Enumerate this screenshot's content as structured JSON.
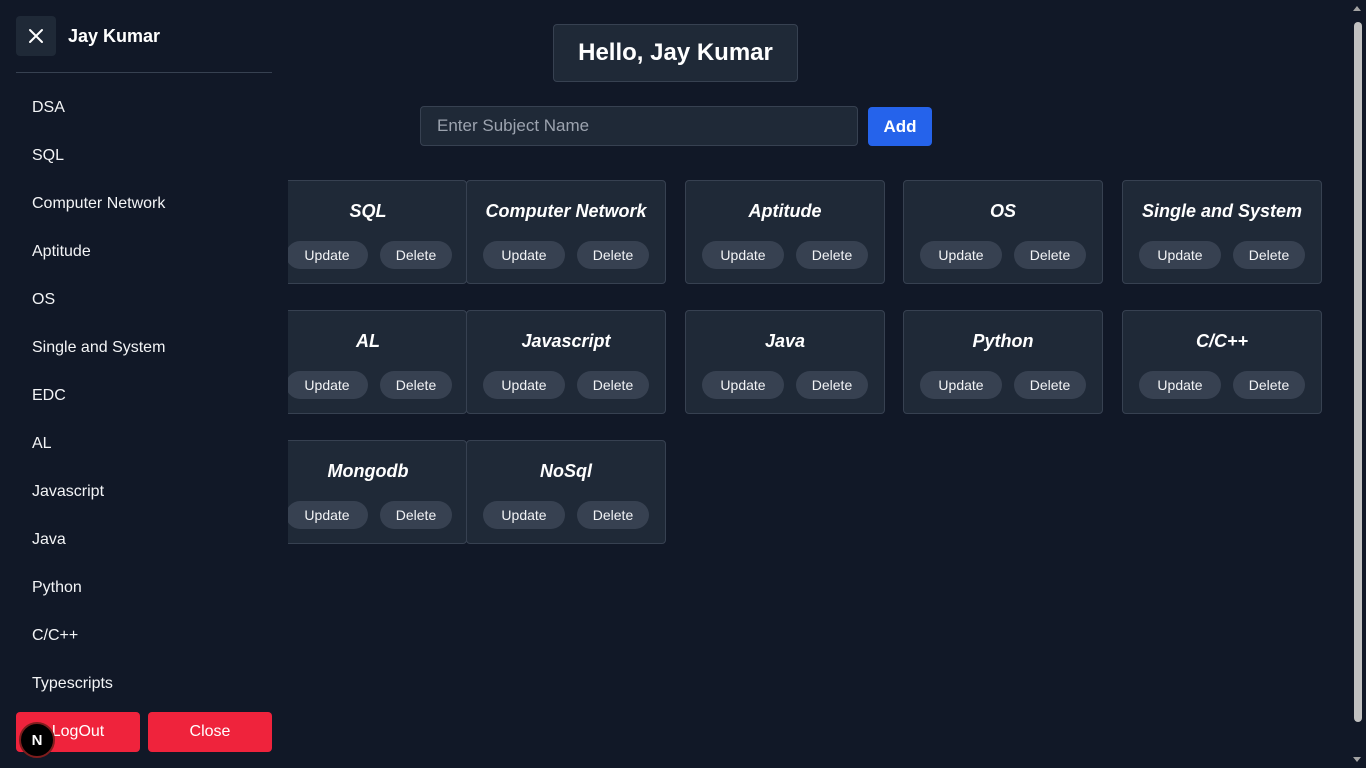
{
  "header": {
    "greeting": "Hello, Jay Kumar"
  },
  "form": {
    "placeholder": "Enter Subject Name",
    "value": "",
    "add_label": "Add"
  },
  "cards": [
    {
      "title": "SQL",
      "update": "Update",
      "delete": "Delete"
    },
    {
      "title": "Computer Network",
      "update": "Update",
      "delete": "Delete"
    },
    {
      "title": "Aptitude",
      "update": "Update",
      "delete": "Delete"
    },
    {
      "title": "OS",
      "update": "Update",
      "delete": "Delete"
    },
    {
      "title": "Single and System",
      "update": "Update",
      "delete": "Delete"
    },
    {
      "title": "AL",
      "update": "Update",
      "delete": "Delete"
    },
    {
      "title": "Javascript",
      "update": "Update",
      "delete": "Delete"
    },
    {
      "title": "Java",
      "update": "Update",
      "delete": "Delete"
    },
    {
      "title": "Python",
      "update": "Update",
      "delete": "Delete"
    },
    {
      "title": "C/C++",
      "update": "Update",
      "delete": "Delete"
    },
    {
      "title": "Mongodb",
      "update": "Update",
      "delete": "Delete"
    },
    {
      "title": "NoSql",
      "update": "Update",
      "delete": "Delete"
    }
  ],
  "sidebar": {
    "user_name": "Jay Kumar",
    "close_icon": "close-icon",
    "items": [
      {
        "label": "DSA"
      },
      {
        "label": "SQL"
      },
      {
        "label": "Computer Network"
      },
      {
        "label": "Aptitude"
      },
      {
        "label": "OS"
      },
      {
        "label": "Single and System"
      },
      {
        "label": "EDC"
      },
      {
        "label": "AL"
      },
      {
        "label": "Javascript"
      },
      {
        "label": "Java"
      },
      {
        "label": "Python"
      },
      {
        "label": "C/C++"
      },
      {
        "label": "Typescripts"
      }
    ],
    "logout_label": "LogOut",
    "close_label": "Close"
  },
  "badge": {
    "letter": "N"
  },
  "colors": {
    "background": "#111827",
    "accent": "#2563eb",
    "danger": "#ef233c",
    "card": "#1f2937"
  }
}
